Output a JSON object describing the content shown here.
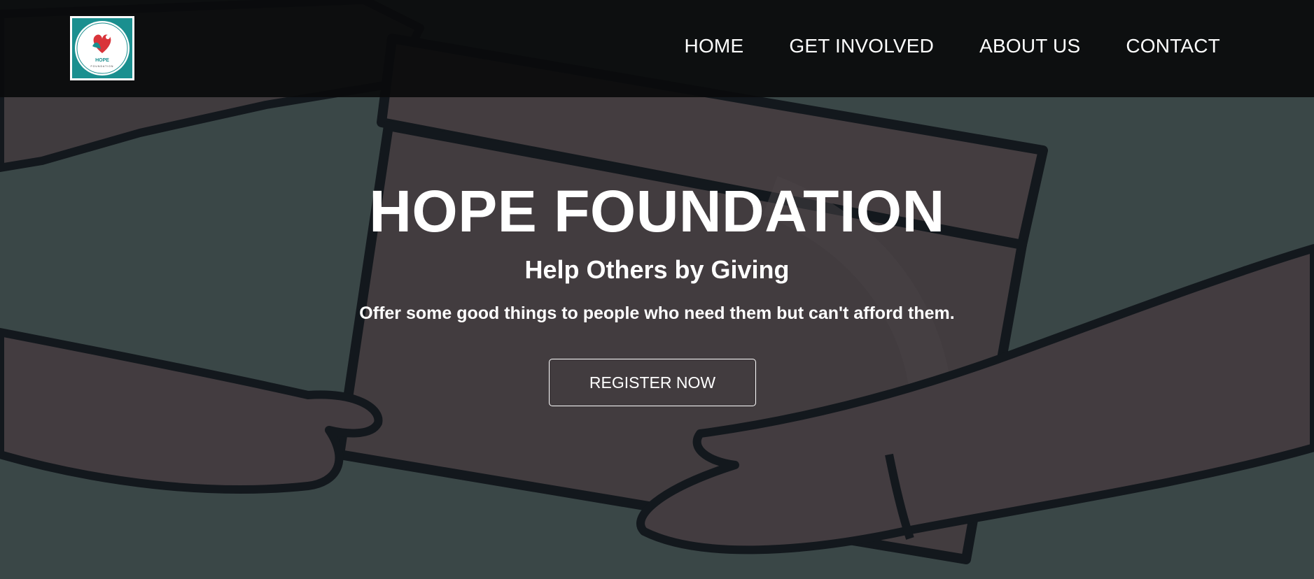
{
  "brand": {
    "logo_text": "HOPE",
    "logo_subtext": "FOUNDATION",
    "colors": {
      "teal": "#1a8f8f",
      "heart_red": "#d9343a",
      "white": "#ffffff"
    }
  },
  "nav": {
    "items": [
      {
        "label": "HOME",
        "icon": null
      },
      {
        "label": "GET INVOLVED",
        "icon": null
      },
      {
        "label": "ABOUT US",
        "icon": null
      },
      {
        "label": "CONTACT",
        "icon": null
      }
    ]
  },
  "hero": {
    "title": "HOPE FOUNDATION",
    "subtitle": "Help Others by Giving",
    "tagline": "Offer some good things to people who need them but can't afford them.",
    "cta_label": "REGISTER NOW",
    "background_image": "hands-giving-box-illustration",
    "overlay_color": "#2f3a3a"
  }
}
